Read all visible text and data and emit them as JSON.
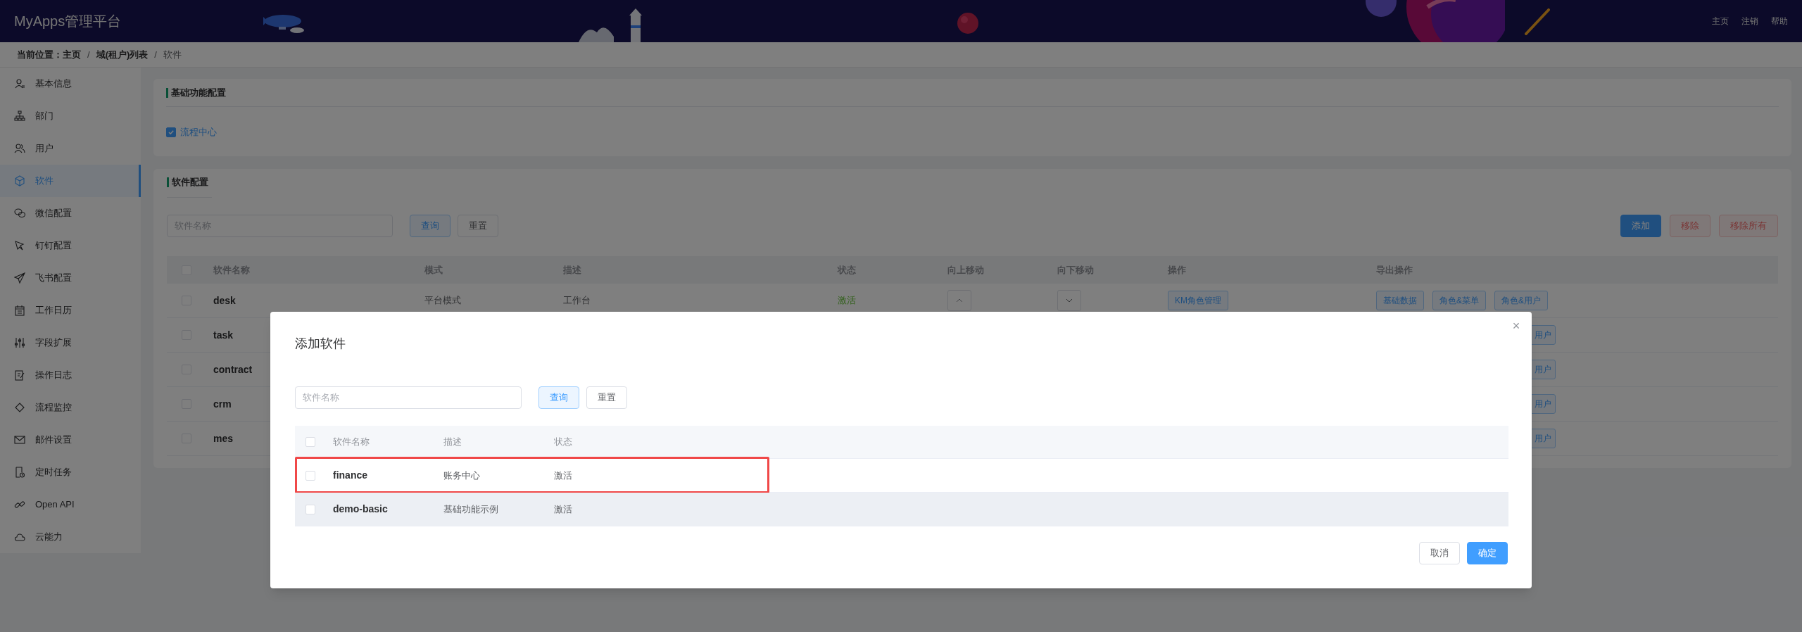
{
  "header": {
    "title": "MyApps管理平台",
    "links": [
      "主页",
      "注销",
      "帮助"
    ]
  },
  "breadcrumb": {
    "label": "当前位置：",
    "separator": "/",
    "items": [
      "主页",
      "域(租户)列表",
      "软件"
    ]
  },
  "sidebar": {
    "items": [
      {
        "label": "基本信息",
        "selected": false
      },
      {
        "label": "部门",
        "selected": false
      },
      {
        "label": "用户",
        "selected": false
      },
      {
        "label": "软件",
        "selected": true
      },
      {
        "label": "微信配置",
        "selected": false
      },
      {
        "label": "钉钉配置",
        "selected": false
      },
      {
        "label": "飞书配置",
        "selected": false
      },
      {
        "label": "工作日历",
        "selected": false
      },
      {
        "label": "字段扩展",
        "selected": false
      },
      {
        "label": "操作日志",
        "selected": false
      },
      {
        "label": "流程监控",
        "selected": false
      },
      {
        "label": "邮件设置",
        "selected": false
      },
      {
        "label": "定时任务",
        "selected": false
      },
      {
        "label": "Open API",
        "selected": false
      },
      {
        "label": "云能力",
        "selected": false
      }
    ]
  },
  "basic_config": {
    "title": "基础功能配置",
    "options": [
      {
        "label": "流程中心",
        "checked": true
      }
    ]
  },
  "software_config": {
    "title": "软件配置",
    "search": {
      "placeholder": "软件名称"
    },
    "search_buttons": [
      "查询",
      "重置"
    ],
    "actions": [
      {
        "label": "添加",
        "kind": "primary"
      },
      {
        "label": "移除",
        "kind": "danger"
      },
      {
        "label": "移除所有",
        "kind": "danger"
      }
    ],
    "table": {
      "all_checked": false,
      "columns": [
        "软件名称",
        "模式",
        "描述",
        "状态",
        "向上移动",
        "向下移动",
        "操作",
        "导出操作"
      ],
      "rows": [
        {
          "checked": false,
          "name": "desk",
          "mode": "平台模式",
          "description": "工作台",
          "status": "激活",
          "active": true,
          "operations": [
            "KM角色管理"
          ],
          "exports": [
            "基础数据",
            "角色&菜单",
            "角色&用户"
          ]
        },
        {
          "checked": false,
          "name": "task",
          "exports_partial": "用户"
        },
        {
          "checked": false,
          "name": "contract",
          "exports_partial": "用户"
        },
        {
          "checked": false,
          "name": "crm",
          "exports_partial": "用户"
        },
        {
          "checked": false,
          "name": "mes",
          "exports_partial": "用户"
        }
      ]
    }
  },
  "dialog": {
    "title": "添加软件",
    "close": "×",
    "search": {
      "placeholder": "软件名称"
    },
    "search_buttons": [
      "查询",
      "重置"
    ],
    "table": {
      "all_checked": false,
      "columns": [
        "软件名称",
        "描述",
        "状态"
      ],
      "rows": [
        {
          "checked": false,
          "highlighted": true,
          "hovered": false,
          "name": "finance",
          "description": "账务中心",
          "status": "激活"
        },
        {
          "checked": false,
          "highlighted": false,
          "hovered": true,
          "name": "demo-basic",
          "description": "基础功能示例",
          "status": "激活"
        }
      ]
    },
    "footer_buttons": [
      {
        "label": "取消",
        "kind": "default"
      },
      {
        "label": "确定",
        "kind": "primary"
      }
    ]
  }
}
